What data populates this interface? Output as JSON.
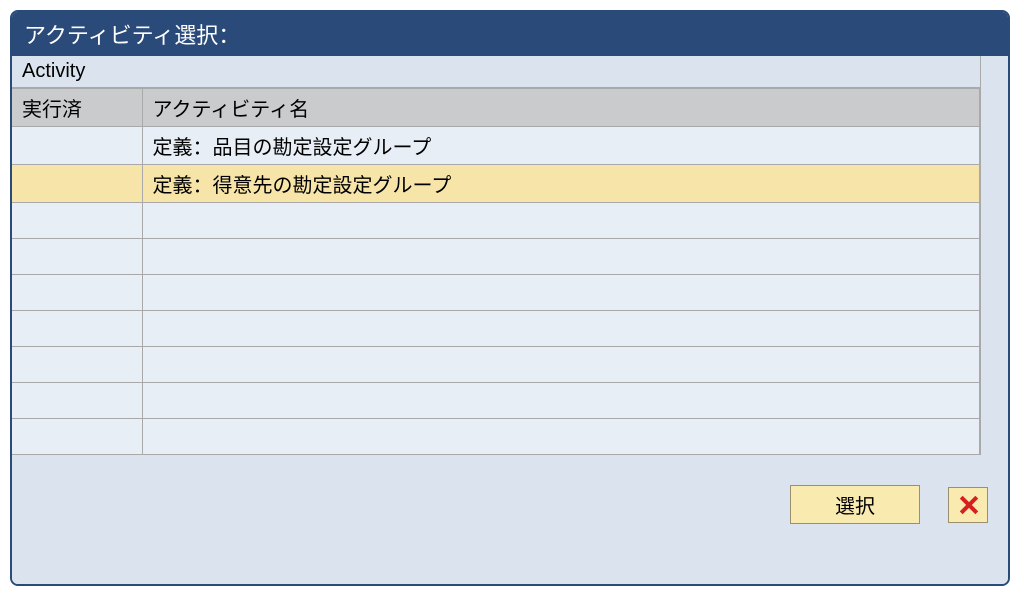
{
  "dialog": {
    "title": "アクティビティ選択："
  },
  "table": {
    "caption": "Activity",
    "headers": {
      "executed": "実行済",
      "activity_name": "アクティビティ名"
    },
    "rows": [
      {
        "executed": "",
        "name": "定義：品目の勘定設定グループ",
        "selected": false
      },
      {
        "executed": "",
        "name": "定義：得意先の勘定設定グループ",
        "selected": true
      },
      {
        "executed": "",
        "name": "",
        "selected": false
      },
      {
        "executed": "",
        "name": "",
        "selected": false
      },
      {
        "executed": "",
        "name": "",
        "selected": false
      },
      {
        "executed": "",
        "name": "",
        "selected": false
      },
      {
        "executed": "",
        "name": "",
        "selected": false
      },
      {
        "executed": "",
        "name": "",
        "selected": false
      },
      {
        "executed": "",
        "name": "",
        "selected": false
      }
    ]
  },
  "footer": {
    "select_label": "選択"
  }
}
